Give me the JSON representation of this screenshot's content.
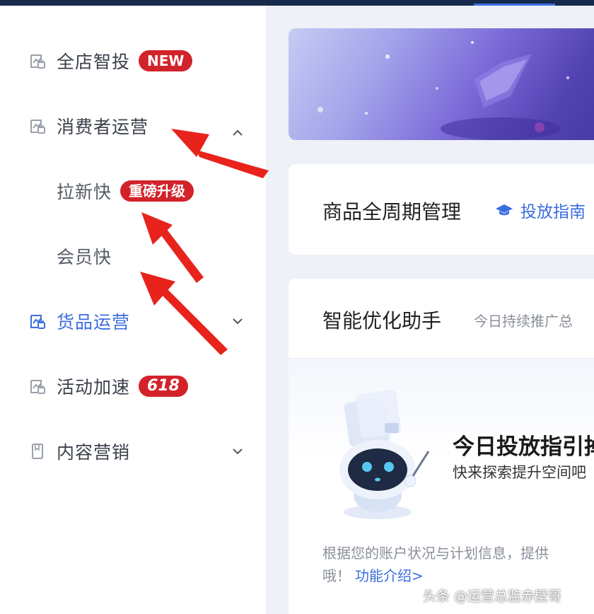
{
  "sidebar": {
    "items": [
      {
        "label": "全店智投",
        "badge": "NEW",
        "icon": "chart-bag-icon"
      },
      {
        "label": "消费者运营",
        "icon": "chart-bag-icon",
        "expanded": true,
        "children": [
          {
            "label": "拉新快",
            "badge": "重磅升级"
          },
          {
            "label": "会员快"
          }
        ]
      },
      {
        "label": "货品运营",
        "icon": "chart-bag-icon",
        "active": true,
        "expanded": false
      },
      {
        "label": "活动加速",
        "badge": "618",
        "icon": "chart-bag-icon"
      },
      {
        "label": "内容营销",
        "icon": "bookmark-doc-icon",
        "expanded": false
      }
    ]
  },
  "product_card": {
    "title": "商品全周期管理",
    "guide_label": "投放指南"
  },
  "assistant_card": {
    "title": "智能优化助手",
    "subtitle": "今日持续推广总",
    "promo_title": "今日投放指引掉",
    "promo_subtitle": "快来探索提升空间吧",
    "desc_line1": "根据您的账户状况与计划信息，提供",
    "desc_line2": "哦！",
    "link_label": "功能介绍>"
  },
  "watermark": "头条 @运营总监赤壁哥",
  "colors": {
    "accent": "#3b6de0",
    "badge_red": "#d3232a",
    "arrow_red": "#e8231c",
    "topbar": "#172a4b"
  }
}
